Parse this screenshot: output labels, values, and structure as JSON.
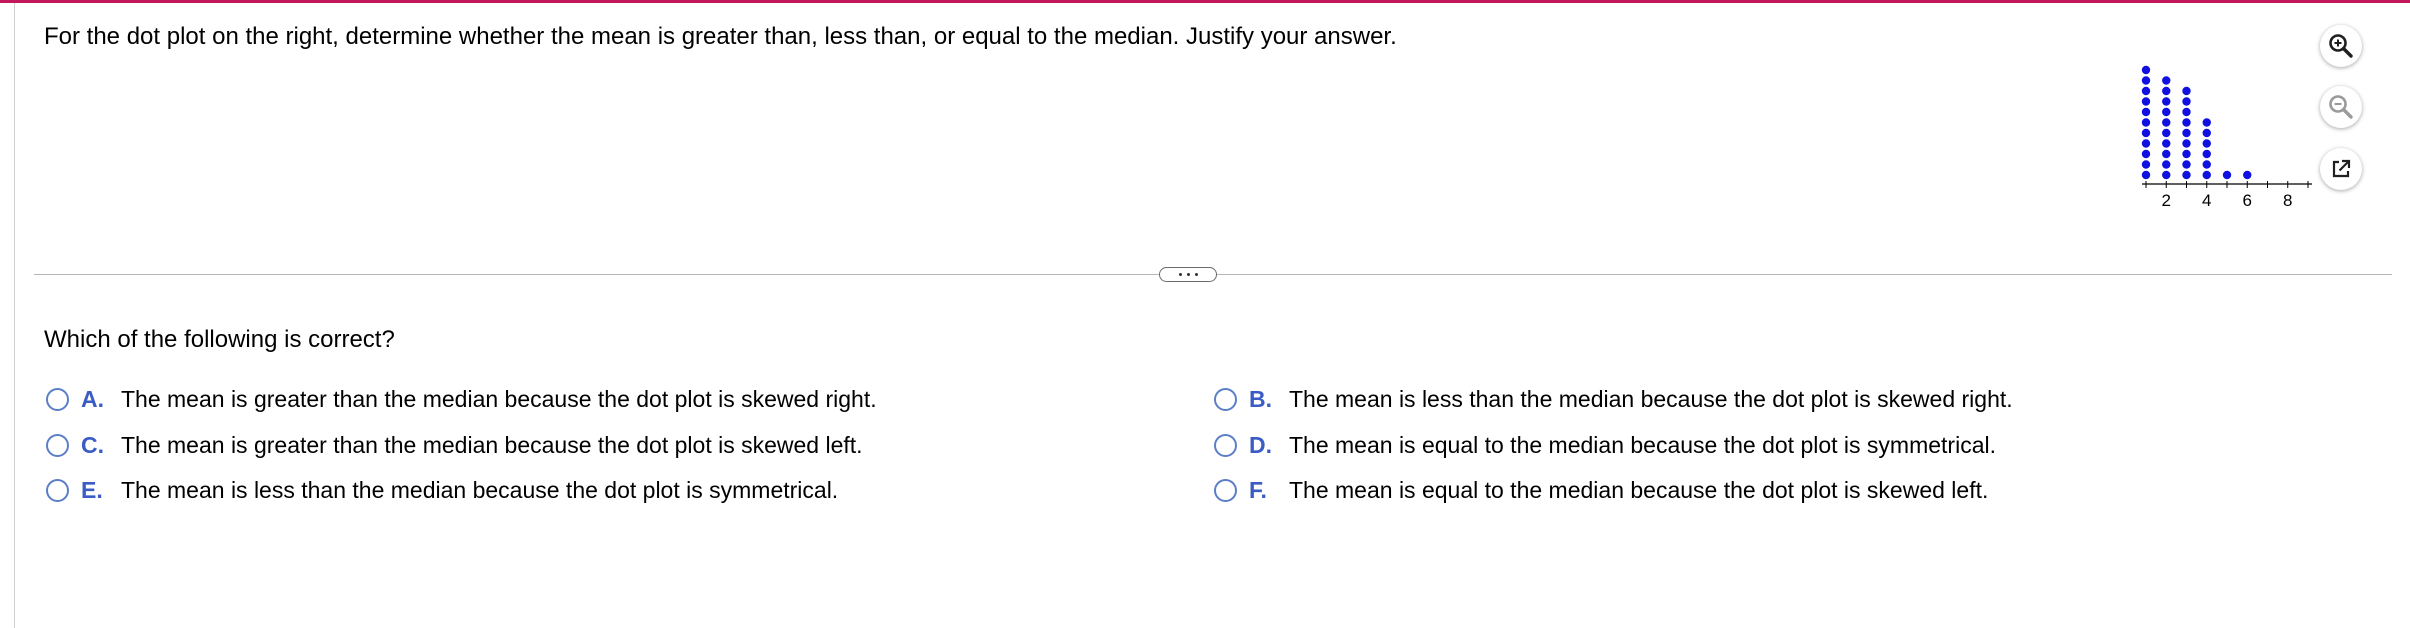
{
  "question": {
    "text": "For the dot plot on the right, determine whether the mean is greater than, less than, or equal to the median. Justify your answer."
  },
  "toolbar": {
    "zoom_in_icon": "magnifier-plus-icon",
    "zoom_out_icon": "magnifier-minus-icon",
    "popout_icon": "external-link-icon"
  },
  "chart_data": {
    "type": "scatter",
    "subtype": "dot plot",
    "xlim": [
      1,
      9
    ],
    "tick_labels": [
      "2",
      "4",
      "6",
      "8"
    ],
    "tick_values": [
      2,
      4,
      6,
      8
    ],
    "x": [
      1,
      2,
      3,
      4,
      5,
      6,
      7,
      8,
      9
    ],
    "counts": [
      11,
      10,
      9,
      6,
      1,
      1,
      0,
      0,
      0
    ],
    "dot_color": "#1010e0",
    "xlabel": "",
    "ylabel": "",
    "title": ""
  },
  "divider": {
    "handle_icon": "ellipsis-icon"
  },
  "prompt": {
    "text": "Which of the following is correct?"
  },
  "options": [
    {
      "letter": "A.",
      "text": "The mean is greater than the median because the dot plot is skewed right."
    },
    {
      "letter": "B.",
      "text": "The mean is less than the median because the dot plot is skewed right."
    },
    {
      "letter": "C.",
      "text": "The mean is greater than the median because the dot plot is skewed left."
    },
    {
      "letter": "D.",
      "text": "The mean is equal to the median because the dot plot is symmetrical."
    },
    {
      "letter": "E.",
      "text": "The mean is less than the median because the dot plot is symmetrical."
    },
    {
      "letter": "F.",
      "text": "The mean is equal to the median because the dot plot is skewed left."
    }
  ],
  "colors": {
    "accent_bar": "#c2185b",
    "option_letter": "#3a5cc4",
    "radio_border": "#5b7fc7"
  }
}
